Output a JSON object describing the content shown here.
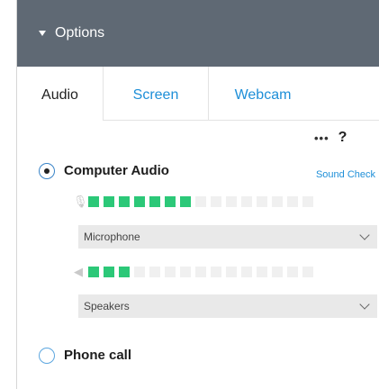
{
  "header": {
    "title": "Options",
    "background": "#5f6974"
  },
  "tabs": [
    {
      "label": "Audio",
      "active": true
    },
    {
      "label": "Screen",
      "active": false
    },
    {
      "label": "Webcam",
      "active": false
    }
  ],
  "tools": {
    "more_icon": "more-icon",
    "more_glyph": "•••",
    "help_glyph": "?"
  },
  "computer_audio": {
    "label": "Computer Audio",
    "selected": true,
    "sound_check_label": "Sound Check",
    "microphone": {
      "icon": "microphone-icon",
      "level_segments_on": 7,
      "level_segments_total": 15,
      "select_value": "Microphone"
    },
    "speakers": {
      "icon": "speaker-icon",
      "level_segments_on": 3,
      "level_segments_total": 15,
      "select_value": "Speakers"
    }
  },
  "phone_call": {
    "label": "Phone call",
    "selected": false
  },
  "colors": {
    "accent": "#1e8fd8",
    "meter_on": "#2cc878",
    "meter_off": "#f0f0f0"
  }
}
